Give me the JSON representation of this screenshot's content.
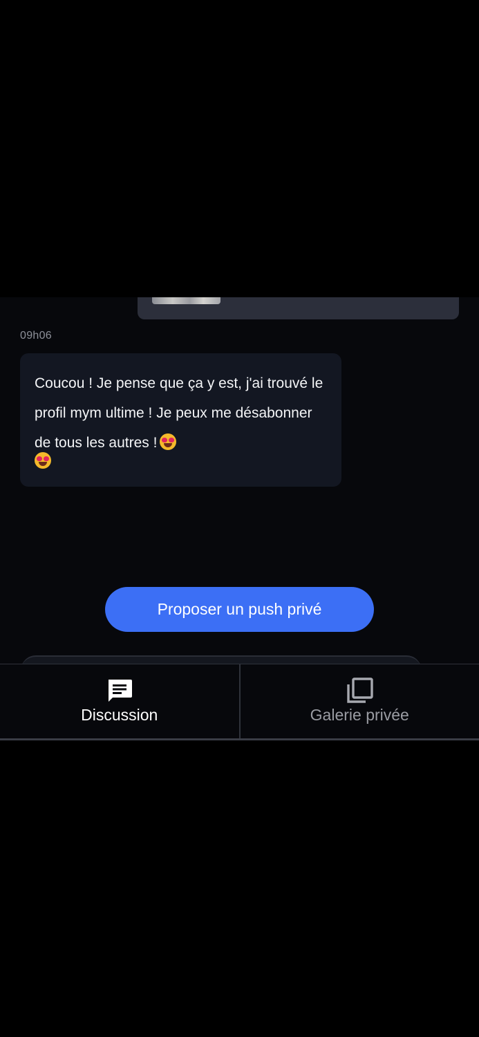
{
  "chat": {
    "timestamp": "09h06",
    "received_message": "Coucou ! Je pense que ça y est, j'ai trouvé le profil mym ultime ! Je peux me désabonner de tous les autres !",
    "emojis": [
      "smiling-face-with-heart-eyes",
      "smiling-face-with-heart-eyes"
    ]
  },
  "actions": {
    "push_button_label": "Proposer un push privé"
  },
  "tabs": [
    {
      "label": "Discussion",
      "icon": "chat-bubble-icon",
      "active": true
    },
    {
      "label": "Galerie privée",
      "icon": "gallery-icon",
      "active": false
    }
  ],
  "colors": {
    "accent": "#3c6ff5",
    "bubble_received": "#131722",
    "bubble_sent": "#2c2f3b",
    "background": "#07080c"
  }
}
